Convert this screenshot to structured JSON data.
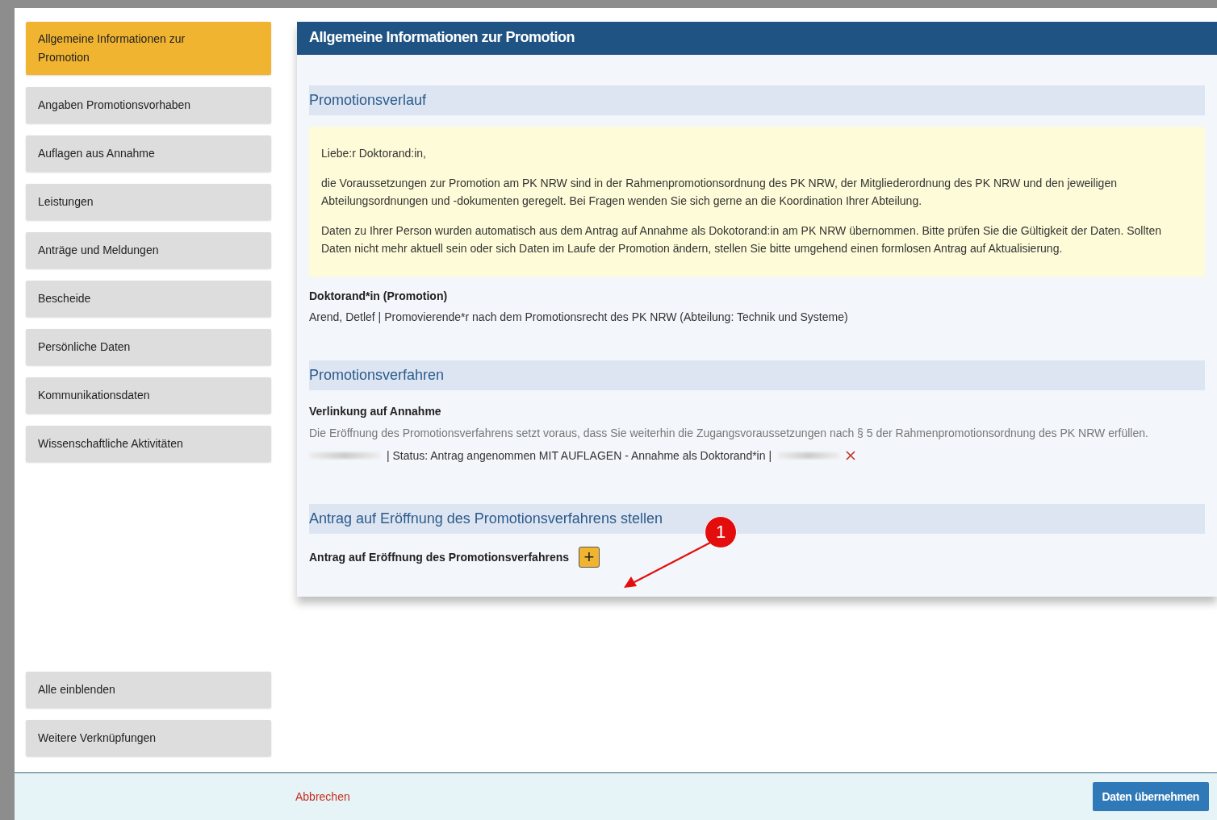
{
  "sidebar": {
    "items": [
      {
        "label": "Allgemeine Informationen zur Promotion",
        "selected": true
      },
      {
        "label": "Angaben Promotionsvorhaben",
        "selected": false
      },
      {
        "label": "Auflagen aus Annahme",
        "selected": false
      },
      {
        "label": "Leistungen",
        "selected": false
      },
      {
        "label": "Anträge und Meldungen",
        "selected": false
      },
      {
        "label": "Bescheide",
        "selected": false
      },
      {
        "label": "Persönliche Daten",
        "selected": false
      },
      {
        "label": "Kommunikationsdaten",
        "selected": false
      },
      {
        "label": "Wissenschaftliche Aktivitäten",
        "selected": false
      }
    ],
    "bottom_items": [
      {
        "label": "Alle einblenden"
      },
      {
        "label": "Weitere Verknüpfungen"
      }
    ]
  },
  "main": {
    "title": "Allgemeine Informationen zur Promotion",
    "promotionsverlauf": {
      "heading": "Promotionsverlauf",
      "notice": [
        "Liebe:r Doktorand:in,",
        "die Voraussetzungen zur Promotion am PK NRW sind in der Rahmenpromotionsordnung des PK NRW, der Mitgliederordnung des PK NRW und den jeweiligen Abteilungsordnungen und -dokumenten geregelt. Bei Fragen wenden Sie sich gerne an die Koordination Ihrer Abteilung.",
        "Daten zu Ihrer Person wurden automatisch aus dem Antrag auf Annahme als Dokotorand:in am PK NRW übernommen. Bitte prüfen Sie die Gültigkeit der Daten. Sollten Daten nicht mehr aktuell sein oder sich Daten im Laufe der Promotion ändern, stellen Sie bitte umgehend einen formlosen Antrag auf Aktualisierung."
      ],
      "field_label": "Doktorand*in (Promotion)",
      "field_value": "Arend, Detlef | Promovierende*r nach dem Promotionsrecht des PK NRW (Abteilung: Technik und Systeme)"
    },
    "promotionsverfahren": {
      "heading": "Promotionsverfahren",
      "field_label": "Verlinkung auf Annahme",
      "hint": "Die Eröffnung des Promotionsverfahrens setzt voraus, dass Sie weiterhin die Zugangsvoraussetzungen nach § 5 der Rahmenpromotionsordnung des PK NRW erfüllen.",
      "link_status": "| Status: Antrag angenommen MIT AUFLAGEN - Annahme als Doktorand*in |"
    },
    "antrag": {
      "heading": "Antrag auf Eröffnung des Promotionsverfahrens stellen",
      "field_label": "Antrag auf Eröffnung des Promotionsverfahrens",
      "add_symbol": "+"
    }
  },
  "callout": {
    "number": "1"
  },
  "footer": {
    "cancel": "Abbrechen",
    "submit": "Daten übernehmen"
  }
}
